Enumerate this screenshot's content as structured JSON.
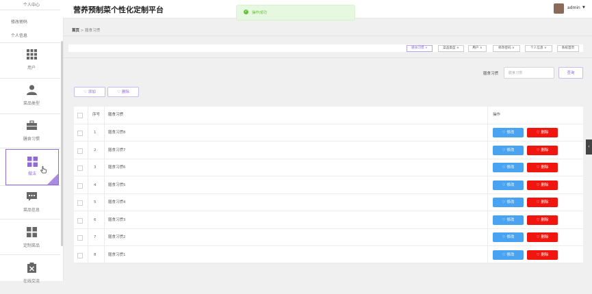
{
  "sidebar": {
    "top_items": [
      "个人中心",
      "修改密码",
      "个人信息"
    ],
    "items": [
      {
        "label": "用户",
        "icon": "grid-icon"
      },
      {
        "label": "菜品类型",
        "icon": "user-icon"
      },
      {
        "label": "膳食习惯",
        "icon": "briefcase-icon"
      },
      {
        "label": "做法",
        "icon": "apps-icon"
      },
      {
        "label": "菜品信息",
        "icon": "chat-icon"
      },
      {
        "label": "定制菜品",
        "icon": "apps-icon"
      },
      {
        "label": "在线交流",
        "icon": "clipboard-icon"
      }
    ],
    "active_index": 3
  },
  "header": {
    "title": "营养预制菜个性化定制平台",
    "user": "admin"
  },
  "toast": {
    "message": "操作成功"
  },
  "breadcrumb": {
    "home": "首页",
    "current": "膳食习惯"
  },
  "tags": [
    "膳食习惯 ×",
    "菜品类型 ×",
    "用户 ×",
    "修改密码 ×",
    "个人信息 ×",
    "系统首页"
  ],
  "search": {
    "label": "膳食习惯",
    "placeholder": "膳食习惯",
    "button": "查询"
  },
  "ops": {
    "add": "♡ 添加",
    "delete": "♡ 删除"
  },
  "table": {
    "headers": {
      "index": "序号",
      "name": "膳食习惯",
      "ops": "操作"
    },
    "edit_label": "♡ 修改",
    "delete_label": "♡ 删除",
    "rows": [
      {
        "index": "1",
        "name": "膳食习惯8"
      },
      {
        "index": "2",
        "name": "膳食习惯7"
      },
      {
        "index": "3",
        "name": "膳食习惯6"
      },
      {
        "index": "4",
        "name": "膳食习惯5"
      },
      {
        "index": "5",
        "name": "膳食习惯4"
      },
      {
        "index": "6",
        "name": "膳食习惯3"
      },
      {
        "index": "7",
        "name": "膳食习惯2"
      },
      {
        "index": "8",
        "name": "膳食习惯1"
      }
    ]
  },
  "colors": {
    "accent": "#8f6bd6",
    "edit": "#4aa3f0",
    "delete": "#f0150f",
    "success": "#67c23a"
  }
}
